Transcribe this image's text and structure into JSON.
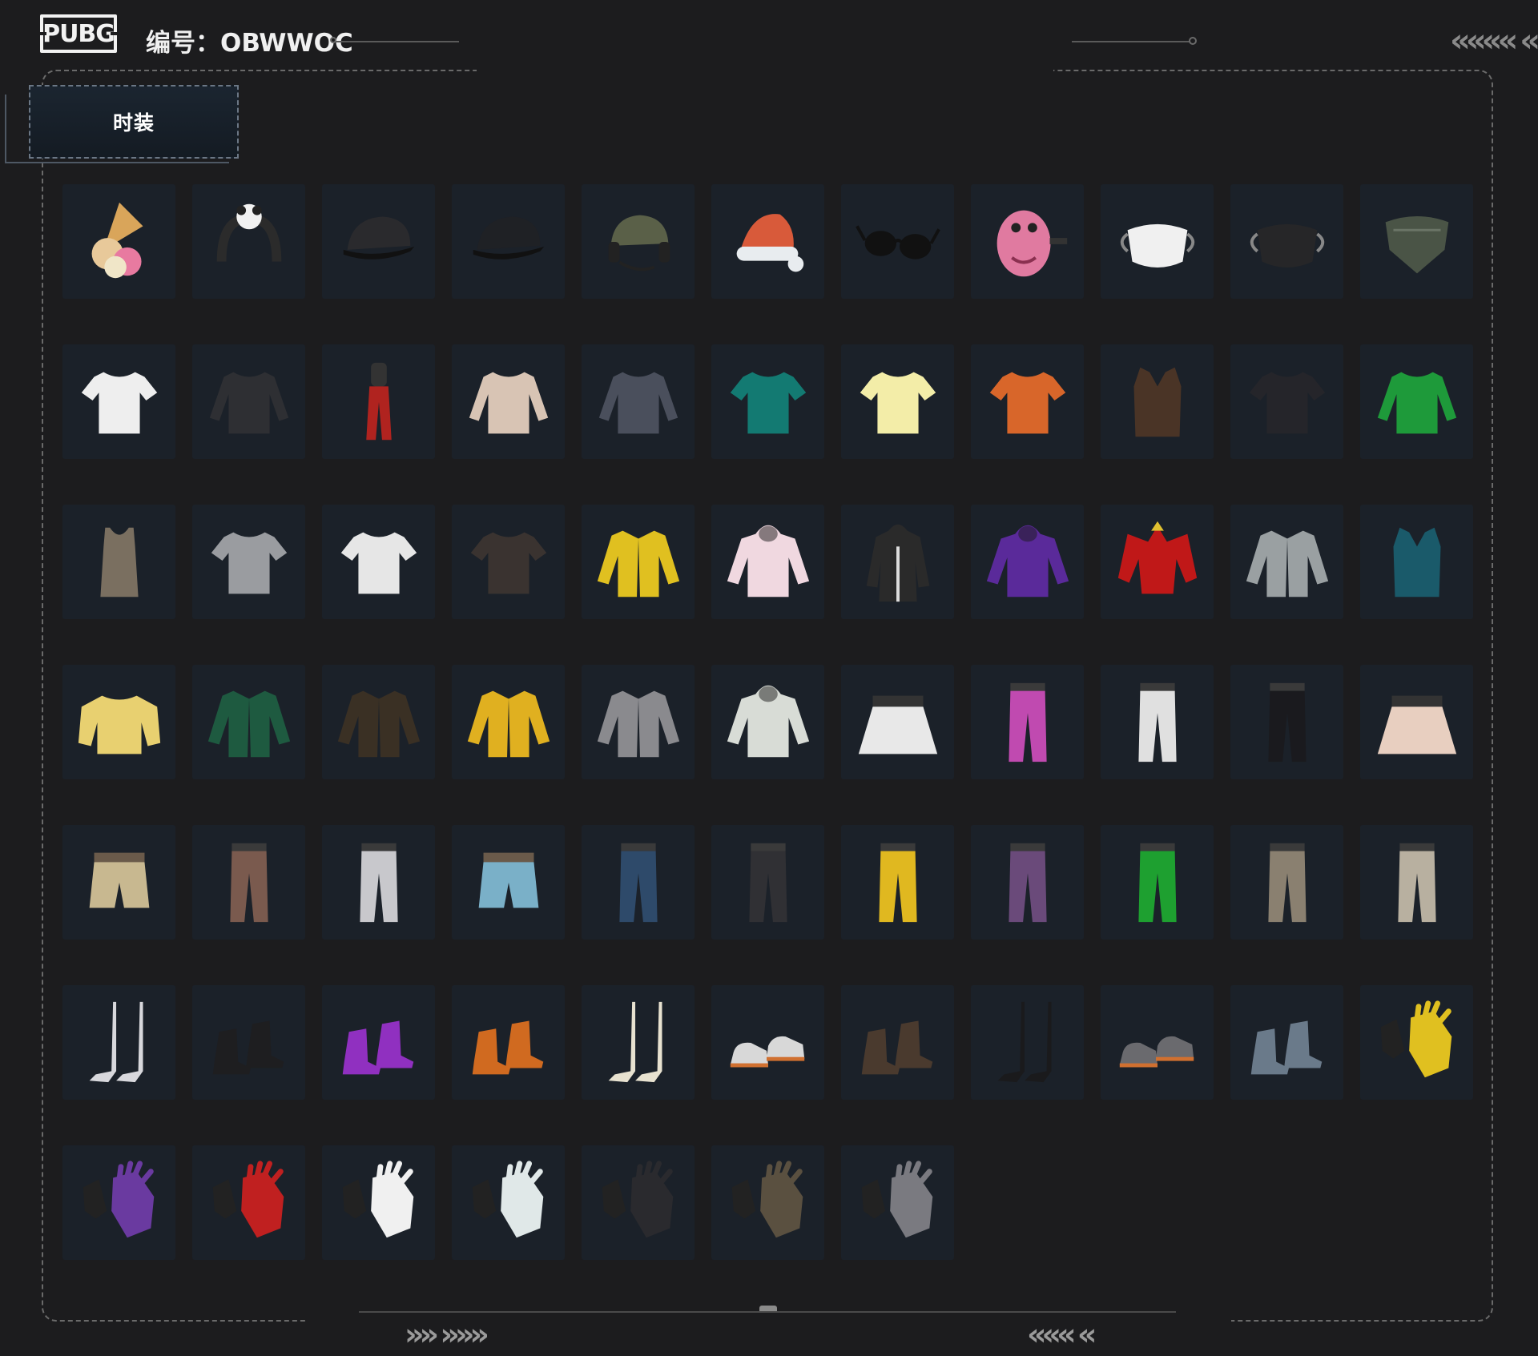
{
  "header": {
    "logo_text": "PUBG",
    "serial_text": "编号：OBWWOC"
  },
  "tab": {
    "label": "时装"
  },
  "decor": {
    "top_chevrons": "«««« «",
    "bottom_left_chevrons": "»» »»»",
    "bottom_right_chevrons": "««« «"
  },
  "colors": {
    "background": "#1c1c1e",
    "tile": "#1b2129",
    "frame_border": "#6a6a6a"
  },
  "items": [
    {
      "icon": "ice-cream-icon",
      "shape": "cone",
      "color": "#e8c99a"
    },
    {
      "icon": "panda-headband-icon",
      "shape": "band",
      "color": "#2b2b2b"
    },
    {
      "icon": "black-cap-icon",
      "shape": "cap",
      "color": "#2a2a2d"
    },
    {
      "icon": "black-cap-green-icon",
      "shape": "cap",
      "color": "#1f2125"
    },
    {
      "icon": "headset-helmet-icon",
      "shape": "helmet",
      "color": "#5a6048"
    },
    {
      "icon": "santa-hat-icon",
      "shape": "hat",
      "color": "#d85a3a"
    },
    {
      "icon": "sunglasses-icon",
      "shape": "glasses",
      "color": "#111111"
    },
    {
      "icon": "pink-dino-mask-icon",
      "shape": "mask",
      "color": "#e07aa0"
    },
    {
      "icon": "white-face-mask-icon",
      "shape": "facemask",
      "color": "#f0f0f0"
    },
    {
      "icon": "black-face-mask-icon",
      "shape": "facemask",
      "color": "#262628"
    },
    {
      "icon": "camo-bandana-icon",
      "shape": "bandana",
      "color": "#4a5446"
    },
    {
      "icon": "white-tshirt-print-icon",
      "shape": "tshirt",
      "color": "#eeeeee"
    },
    {
      "icon": "black-long-shirt-icon",
      "shape": "longsleeve",
      "color": "#2e2f33"
    },
    {
      "icon": "red-outfit-icon",
      "shape": "dress",
      "color": "#b0231f"
    },
    {
      "icon": "floral-shirt-icon",
      "shape": "longsleeve",
      "color": "#d8c4b4"
    },
    {
      "icon": "plaid-shirt-icon",
      "shape": "longsleeve",
      "color": "#4a4f5c"
    },
    {
      "icon": "teal-polo-icon",
      "shape": "tshirt",
      "color": "#137a72"
    },
    {
      "icon": "yellow-raglan-tee-icon",
      "shape": "tshirt",
      "color": "#f3eda8"
    },
    {
      "icon": "orange-basketball-tee-icon",
      "shape": "tshirt",
      "color": "#d8662a"
    },
    {
      "icon": "leather-vest-icon",
      "shape": "vest",
      "color": "#4a3426"
    },
    {
      "icon": "graphic-black-tee-icon",
      "shape": "tshirt",
      "color": "#25252a"
    },
    {
      "icon": "green-jersey-icon",
      "shape": "longsleeve",
      "color": "#1e9a3a"
    },
    {
      "icon": "tank-top-icon",
      "shape": "tank",
      "color": "#7a6f60"
    },
    {
      "icon": "grey-tshirt-icon",
      "shape": "tshirt",
      "color": "#9a9ca0"
    },
    {
      "icon": "white-vneck-icon",
      "shape": "tshirt",
      "color": "#e6e6e6"
    },
    {
      "icon": "winner-tshirt-icon",
      "shape": "tshirt",
      "color": "#3a3330"
    },
    {
      "icon": "yellow-moto-jacket-icon",
      "shape": "jacket",
      "color": "#e0c020"
    },
    {
      "icon": "pink-hoodie-icon",
      "shape": "hoodie",
      "color": "#f0d8e0"
    },
    {
      "icon": "long-coat-icon",
      "shape": "coat",
      "color": "#2a2a2a"
    },
    {
      "icon": "purple-bear-hoodie-icon",
      "shape": "hoodie",
      "color": "#5a2a9a"
    },
    {
      "icon": "red-armor-icon",
      "shape": "armor",
      "color": "#c01818"
    },
    {
      "icon": "floral-bomber-icon",
      "shape": "jacket",
      "color": "#9aa0a2"
    },
    {
      "icon": "teal-puffer-vest-icon",
      "shape": "vest",
      "color": "#1a5a6a"
    },
    {
      "icon": "yellow-fuzzy-sweater-icon",
      "shape": "sweater",
      "color": "#e8d070"
    },
    {
      "icon": "varsity-jacket-icon",
      "shape": "jacket",
      "color": "#1e5a40"
    },
    {
      "icon": "camo-leather-jacket-icon",
      "shape": "jacket",
      "color": "#3a3024"
    },
    {
      "icon": "yellow-parka-icon",
      "shape": "jacket",
      "color": "#e0b020"
    },
    {
      "icon": "grey-orange-jacket-icon",
      "shape": "jacket",
      "color": "#8a8a8e"
    },
    {
      "icon": "leaf-hoodie-icon",
      "shape": "hoodie",
      "color": "#d8dcd6"
    },
    {
      "icon": "pleated-skirt-icon",
      "shape": "skirt",
      "color": "#e8e8e8"
    },
    {
      "icon": "psychedelic-leggings-icon",
      "shape": "pants",
      "color": "#c04ab0"
    },
    {
      "icon": "white-cargo-pants-icon",
      "shape": "pants",
      "color": "#e0e0e0"
    },
    {
      "icon": "black-purple-pants-icon",
      "shape": "pants",
      "color": "#1a1a1e"
    },
    {
      "icon": "floral-skirt-icon",
      "shape": "skirt",
      "color": "#e8cfc0"
    },
    {
      "icon": "camo-shorts-icon",
      "shape": "shorts",
      "color": "#c8b890"
    },
    {
      "icon": "brown-pants-icon",
      "shape": "pants",
      "color": "#7a5a4e"
    },
    {
      "icon": "grey-joggers-icon",
      "shape": "pants",
      "color": "#c8c8cc"
    },
    {
      "icon": "denim-shorts-icon",
      "shape": "shorts",
      "color": "#7ab0c8"
    },
    {
      "icon": "blue-jeans-icon",
      "shape": "pants",
      "color": "#2e4a6a"
    },
    {
      "icon": "ripped-black-jeans-icon",
      "shape": "pants",
      "color": "#303034"
    },
    {
      "icon": "yellow-track-pants-icon",
      "shape": "pants",
      "color": "#e0b820"
    },
    {
      "icon": "purple-pants-icon",
      "shape": "pants",
      "color": "#6a4a7a"
    },
    {
      "icon": "green-track-pants-icon",
      "shape": "pants",
      "color": "#1ea030"
    },
    {
      "icon": "khaki-pants-icon",
      "shape": "pants",
      "color": "#8a8070"
    },
    {
      "icon": "beige-cargo-pants-icon",
      "shape": "pants",
      "color": "#b8b0a0"
    },
    {
      "icon": "white-thigh-boots-icon",
      "shape": "tallboots",
      "color": "#d8d8dc"
    },
    {
      "icon": "black-lace-boots-icon",
      "shape": "boots",
      "color": "#1e1e20"
    },
    {
      "icon": "purple-boots-icon",
      "shape": "boots",
      "color": "#9030c0"
    },
    {
      "icon": "flame-boots-icon",
      "shape": "boots",
      "color": "#d06a20"
    },
    {
      "icon": "knee-socks-loafers-icon",
      "shape": "tallboots",
      "color": "#e8e2d0"
    },
    {
      "icon": "orange-sneakers-icon",
      "shape": "sneakers",
      "color": "#d8d8d8"
    },
    {
      "icon": "brown-work-boots-icon",
      "shape": "boots",
      "color": "#4a3a2e"
    },
    {
      "icon": "striped-stockings-icon",
      "shape": "tallboots",
      "color": "#1a1a1c"
    },
    {
      "icon": "grey-flats-icon",
      "shape": "sneakers",
      "color": "#6a6a6e"
    },
    {
      "icon": "denim-boots-icon",
      "shape": "boots",
      "color": "#6a7a8a"
    },
    {
      "icon": "yellow-gloves-icon",
      "shape": "gloves",
      "color": "#e0c020"
    },
    {
      "icon": "purple-gloves-icon",
      "shape": "gloves",
      "color": "#6a3aa0"
    },
    {
      "icon": "red-gloves-icon",
      "shape": "gloves",
      "color": "#c02020"
    },
    {
      "icon": "panda-gloves-icon",
      "shape": "gloves",
      "color": "#f0f0f0"
    },
    {
      "icon": "white-teal-gloves-icon",
      "shape": "gloves",
      "color": "#e0e8e8"
    },
    {
      "icon": "black-fingerless-gloves-icon",
      "shape": "gloves",
      "color": "#2a2a2e"
    },
    {
      "icon": "orange-camo-gloves-icon",
      "shape": "gloves",
      "color": "#5a5040"
    },
    {
      "icon": "grey-fingerless-gloves-icon",
      "shape": "gloves",
      "color": "#7a7a80"
    }
  ]
}
